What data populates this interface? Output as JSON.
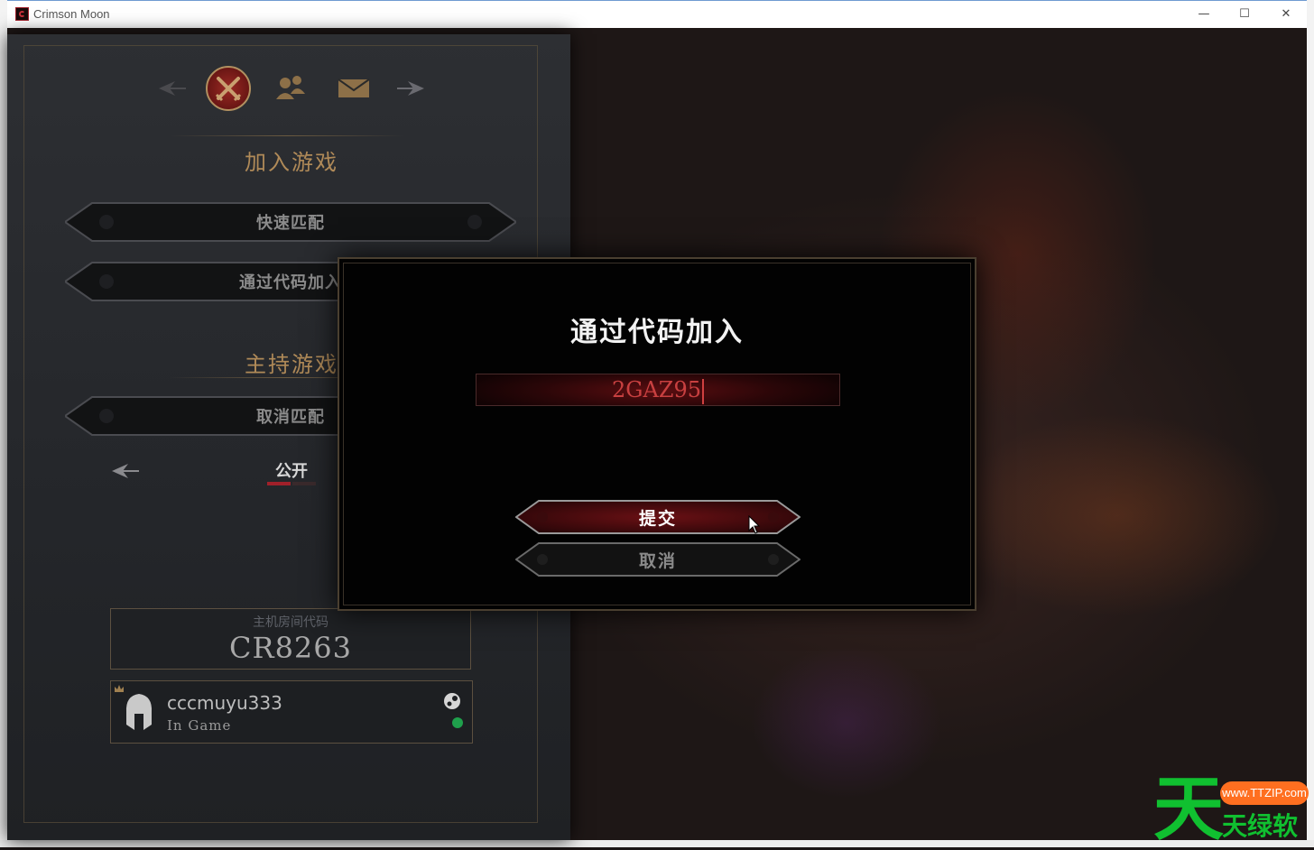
{
  "window": {
    "title": "Crimson Moon",
    "controls": {
      "minimize": "—",
      "maximize": "☐",
      "close": "✕"
    }
  },
  "panel": {
    "nav_icons": [
      "back-arrow-icon",
      "crossed-swords-icon",
      "friends-icon",
      "mail-icon",
      "forward-arrow-icon"
    ],
    "join_section_title": "加入游戏",
    "quick_match_label": "快速匹配",
    "join_by_code_label": "通过代码加入",
    "host_section_title": "主持游戏",
    "cancel_match_label": "取消匹配",
    "visibility_label": "公开",
    "host_code_label": "主机房间代码",
    "host_code_value": "CR8263",
    "player": {
      "name": "cccmuyu333",
      "status": "In Game"
    }
  },
  "modal": {
    "title": "通过代码加入",
    "code_input_value": "2GAZ95",
    "submit_label": "提交",
    "cancel_label": "取消"
  },
  "watermark": {
    "big_char": "天",
    "url": "www.TTZIP.com",
    "sub_text": "天绿软"
  },
  "colors": {
    "accent_red": "#9b2a24",
    "gold": "#b08a58",
    "online_green": "#1fa04c"
  }
}
